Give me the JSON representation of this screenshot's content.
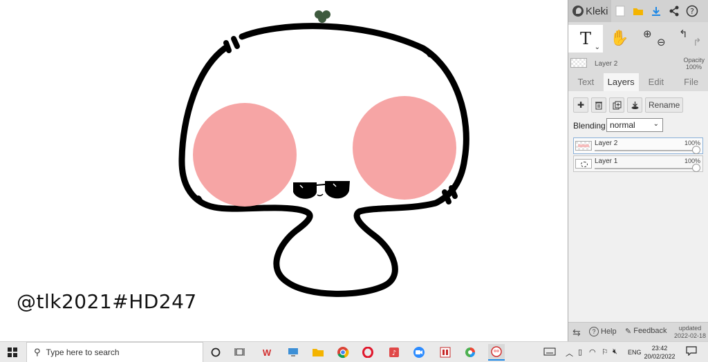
{
  "canvas": {
    "signature": "@tlk2021#HD247"
  },
  "app": {
    "name": "Kleki"
  },
  "tools": {
    "active_tool_glyph": "T"
  },
  "layer_info": {
    "active_layer_name": "Layer 2",
    "opacity_label": "Opacity",
    "opacity_value": "100%"
  },
  "tabs": [
    {
      "label": "Text"
    },
    {
      "label": "Layers"
    },
    {
      "label": "Edit"
    },
    {
      "label": "File"
    }
  ],
  "layers_panel": {
    "rename_label": "Rename",
    "blending_label": "Blending",
    "blending_value": "normal",
    "layers": [
      {
        "name": "Layer 2",
        "opacity": "100%",
        "opacity_fraction": 1.0
      },
      {
        "name": "Layer 1",
        "opacity": "100%",
        "opacity_fraction": 1.0
      }
    ]
  },
  "footer": {
    "help_label": "Help",
    "feedback_label": "Feedback",
    "updated_label": "updated",
    "updated_date": "2022-02-18"
  },
  "taskbar": {
    "search_placeholder": "Type here to search",
    "language": "ENG",
    "time": "23:42",
    "date": "20/02/2022"
  },
  "colors": {
    "cheek": "#f6a5a5",
    "sprout": "#3e5a3e",
    "outline": "#000000",
    "panel_bg": "#dcdcdc",
    "accent_blue": "#1e88e5"
  },
  "icons": {
    "new_image": "new-file-icon",
    "open": "folder-icon",
    "save": "download-icon",
    "share": "share-icon",
    "help": "help-icon",
    "hand": "hand-icon",
    "zoom_in": "zoom-in-icon",
    "zoom_out": "zoom-out-icon",
    "undo": "undo-icon",
    "redo": "redo-icon"
  }
}
